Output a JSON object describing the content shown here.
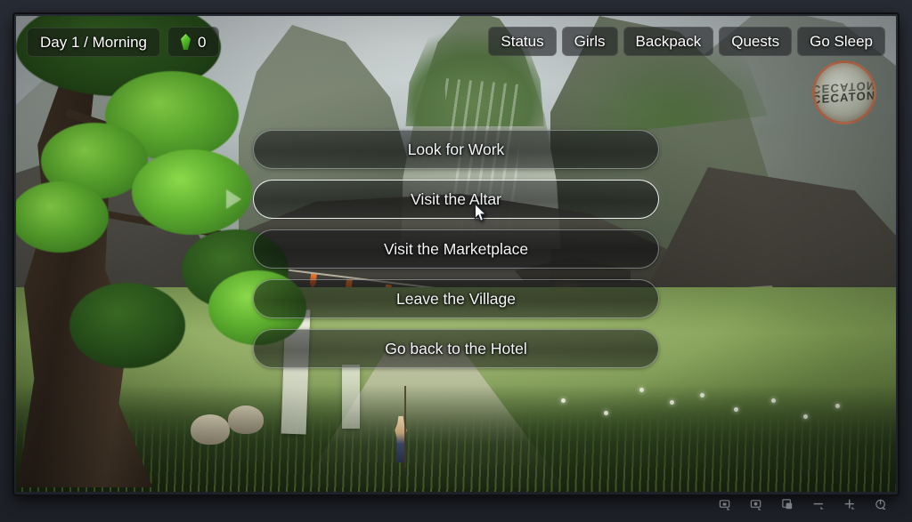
{
  "window": {
    "frame_color": "#22262e",
    "viewport_bg": "#8d948f"
  },
  "hud": {
    "day_time": "Day 1 / Morning",
    "currency": {
      "icon": "gem-icon",
      "amount": "0",
      "color": "#58c22a"
    },
    "menu_buttons": [
      {
        "label": "Status",
        "name": "status"
      },
      {
        "label": "Girls",
        "name": "girls"
      },
      {
        "label": "Backpack",
        "name": "backpack"
      },
      {
        "label": "Quests",
        "name": "quests"
      },
      {
        "label": "Go Sleep",
        "name": "go-sleep"
      }
    ],
    "logo": {
      "text": "CECATON",
      "mirror_text": "CECATON",
      "ring_color": "#a84a26"
    }
  },
  "choices": {
    "selected_index": 1,
    "items": [
      {
        "label": "Look for Work",
        "name": "look-for-work"
      },
      {
        "label": "Visit the Altar",
        "name": "visit-the-altar"
      },
      {
        "label": "Visit the Marketplace",
        "name": "visit-the-marketplace"
      },
      {
        "label": "Leave the Village",
        "name": "leave-the-village"
      },
      {
        "label": "Go back to the Hotel",
        "name": "go-back-to-the-hotel"
      }
    ]
  },
  "taskbar": {
    "icons": [
      {
        "name": "screenshot-icon",
        "glyph": "screen"
      },
      {
        "name": "screen-record-icon",
        "glyph": "screen"
      },
      {
        "name": "multi-window-icon",
        "glyph": "window"
      },
      {
        "name": "volume-down-icon",
        "glyph": "minus"
      },
      {
        "name": "volume-up-icon",
        "glyph": "plus"
      },
      {
        "name": "power-icon",
        "glyph": "power"
      }
    ]
  },
  "scene": {
    "description": "Stylized fantasy village valley at morning with green-capped rock spires, a large foreground tree, banners and orange bunting flags, lantern-lit wooden houses and a grassy path with a small traveler character."
  }
}
